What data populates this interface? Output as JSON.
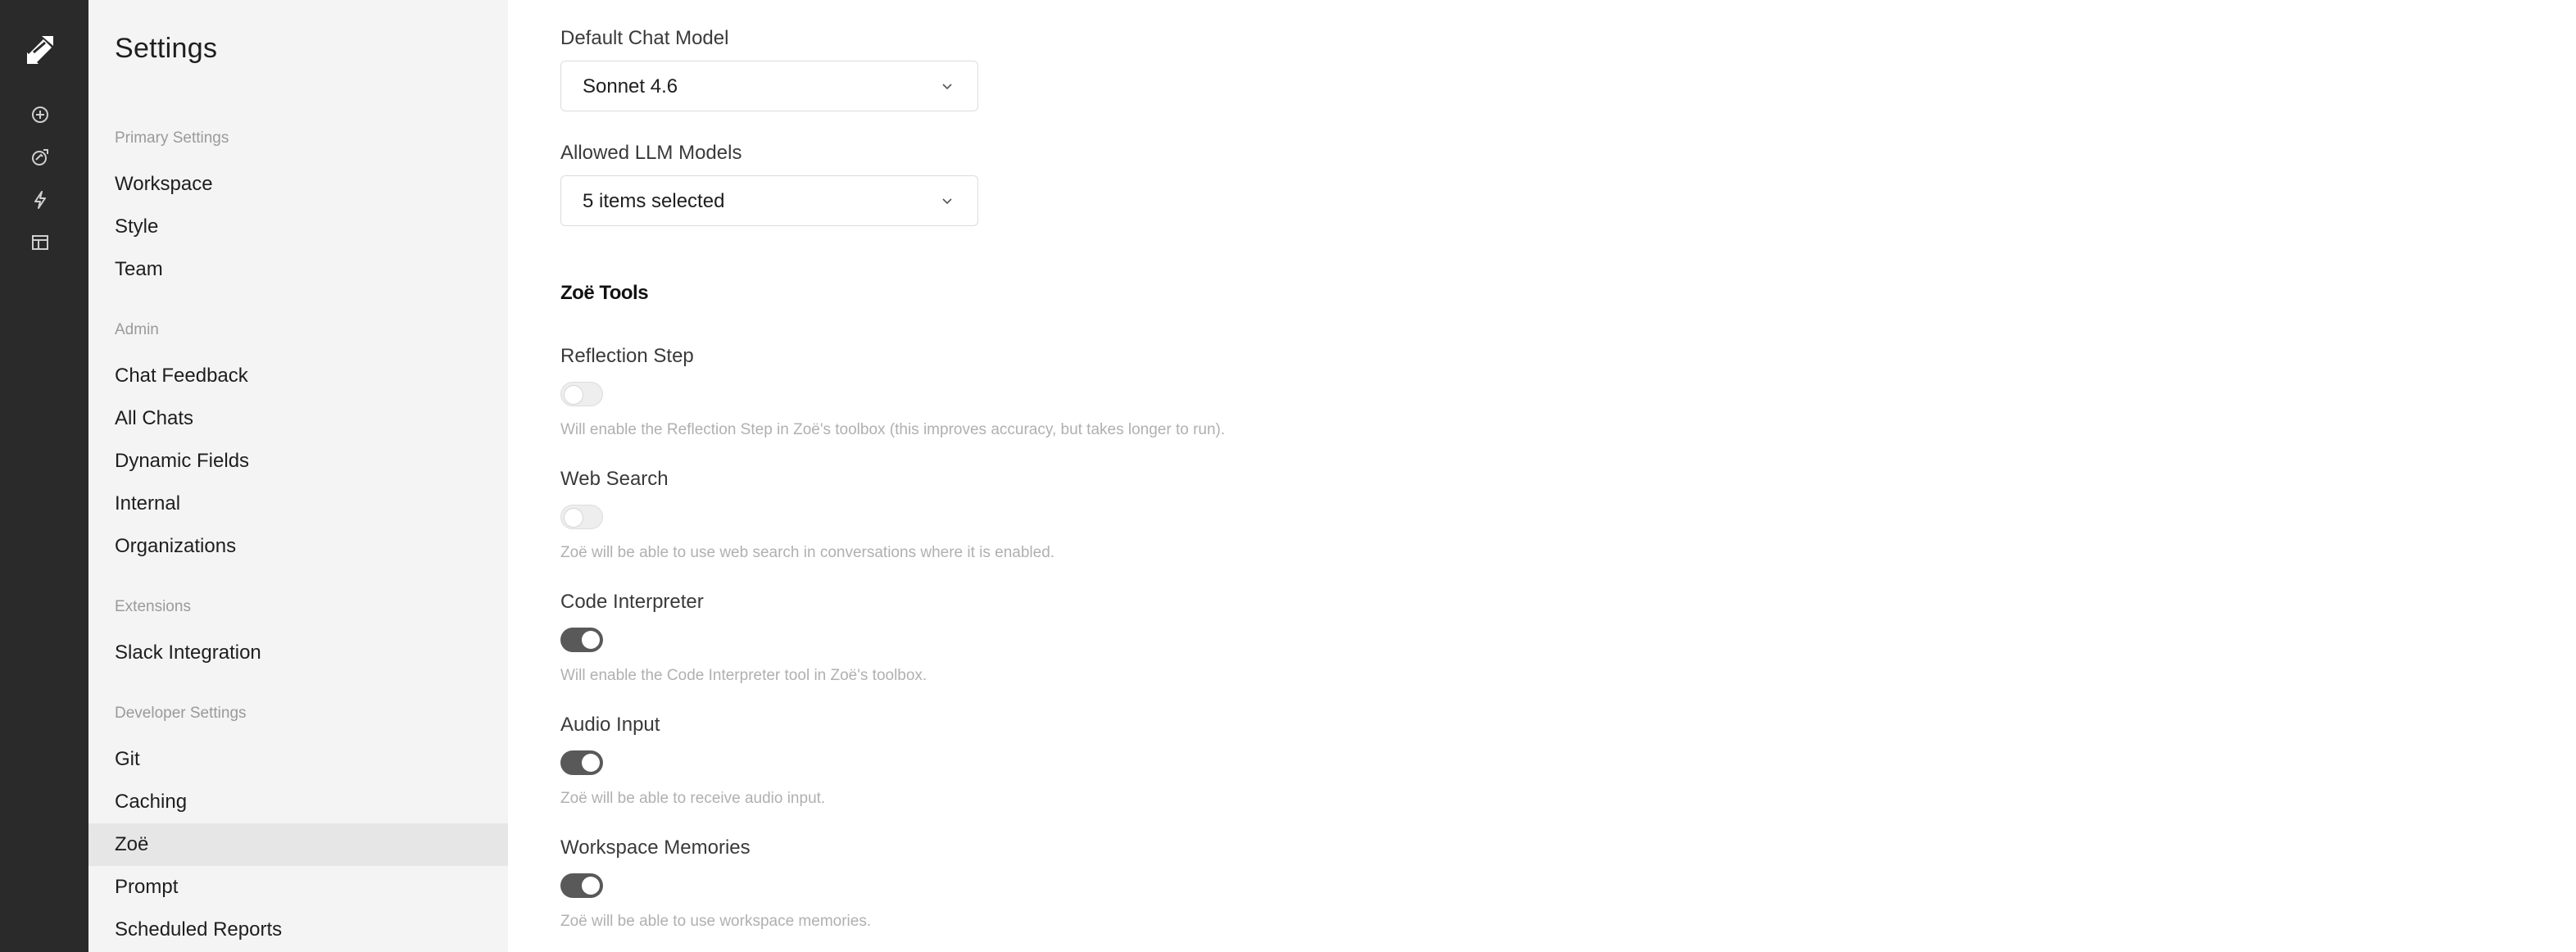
{
  "sidebar": {
    "title": "Settings",
    "sections": [
      {
        "label": "Primary Settings",
        "items": [
          "Workspace",
          "Style",
          "Team"
        ]
      },
      {
        "label": "Admin",
        "items": [
          "Chat Feedback",
          "All Chats",
          "Dynamic Fields",
          "Internal",
          "Organizations"
        ]
      },
      {
        "label": "Extensions",
        "items": [
          "Slack Integration"
        ]
      },
      {
        "label": "Developer Settings",
        "items": [
          "Git",
          "Caching",
          "Zoë",
          "Prompt",
          "Scheduled Reports"
        ]
      }
    ],
    "active_item": "Zoë"
  },
  "rail": {
    "icons": [
      "new-chat-icon",
      "explore-icon",
      "automations-icon",
      "table-icon"
    ]
  },
  "main": {
    "default_model": {
      "label": "Default Chat Model",
      "value": "Sonnet 4.6"
    },
    "allowed_models": {
      "label": "Allowed LLM Models",
      "value": "5 items selected"
    },
    "tools_title": "Zoë Tools",
    "tools": [
      {
        "label": "Reflection Step",
        "enabled": false,
        "help": "Will enable the Reflection Step in Zoë's toolbox (this improves accuracy, but takes longer to run)."
      },
      {
        "label": "Web Search",
        "enabled": false,
        "help": "Zoë will be able to use web search in conversations where it is enabled."
      },
      {
        "label": "Code Interpreter",
        "enabled": true,
        "help": "Will enable the Code Interpreter tool in Zoë's toolbox."
      },
      {
        "label": "Audio Input",
        "enabled": true,
        "help": "Zoë will be able to receive audio input."
      },
      {
        "label": "Workspace Memories",
        "enabled": true,
        "help": "Zoë will be able to use workspace memories."
      }
    ]
  }
}
